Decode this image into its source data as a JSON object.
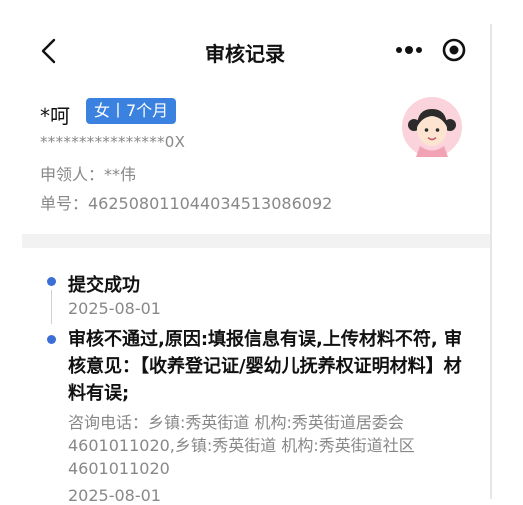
{
  "nav": {
    "title": "审核记录"
  },
  "profile": {
    "name": "*呵",
    "badge": "女丨7个月",
    "id_number": "****************0X",
    "applicant": "申领人：**伟",
    "order_number": "单号：46250801104403451308609​2"
  },
  "timeline": [
    {
      "title": "提交成功",
      "date": "2025-08-01"
    },
    {
      "title": "审核不通过,原因:填报信息有误,上传材料不符, 审核意见：【收养登记证/婴幼儿抚养权证明材料】材料有误;",
      "info": "咨询电话：乡镇:秀英街道 机构:秀英街道居委会4601011020,乡镇:秀英街道 机构:秀英街道社区4601011020",
      "date": "2025-08-01"
    }
  ],
  "colors": {
    "accent": "#3b82e0",
    "timeline_dot": "#3b6fd8"
  },
  "icons": [
    "back-arrow-icon",
    "more-dots-icon",
    "target-icon",
    "avatar-girl-icon"
  ]
}
